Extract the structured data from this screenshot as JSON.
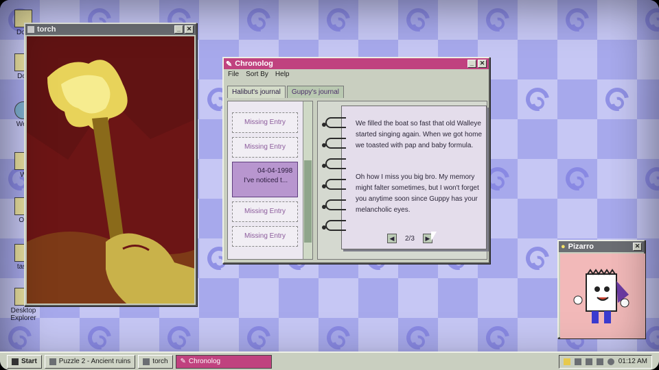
{
  "desktop": {
    "icons": [
      {
        "label": "Dow"
      },
      {
        "label": "Doc"
      },
      {
        "label": "Web"
      },
      {
        "label": "W"
      },
      {
        "label": "Op"
      },
      {
        "label": "task"
      },
      {
        "label": "Desktop Explorer"
      }
    ]
  },
  "torch_window": {
    "title": "torch"
  },
  "chronolog": {
    "title": "Chronolog",
    "menu": [
      "File",
      "Sort By",
      "Help"
    ],
    "tabs": [
      "Halibut's journal",
      "Guppy's journal"
    ],
    "entries": [
      {
        "label": "Missing Entry"
      },
      {
        "label": "Missing Entry"
      },
      {
        "date": "04-04-1998",
        "preview": "I've noticed t..."
      },
      {
        "label": "Missing Entry"
      },
      {
        "label": "Missing Entry"
      }
    ],
    "page_paragraph_1": "We filled the boat so fast that old Walleye started singing again. When we got home we toasted with pap and baby formula.",
    "page_paragraph_2": "Oh how I miss you big bro. My memory might falter sometimes, but I won't forget you anytime soon since Guppy has your melancholic eyes.",
    "page_indicator": "2/3"
  },
  "pizarro_window": {
    "title": "Pizarro"
  },
  "taskbar": {
    "start_label": "Start",
    "items": [
      "Puzzle 2 - Ancient ruins",
      "torch",
      "Chronolog"
    ],
    "time": "01:12 AM"
  }
}
